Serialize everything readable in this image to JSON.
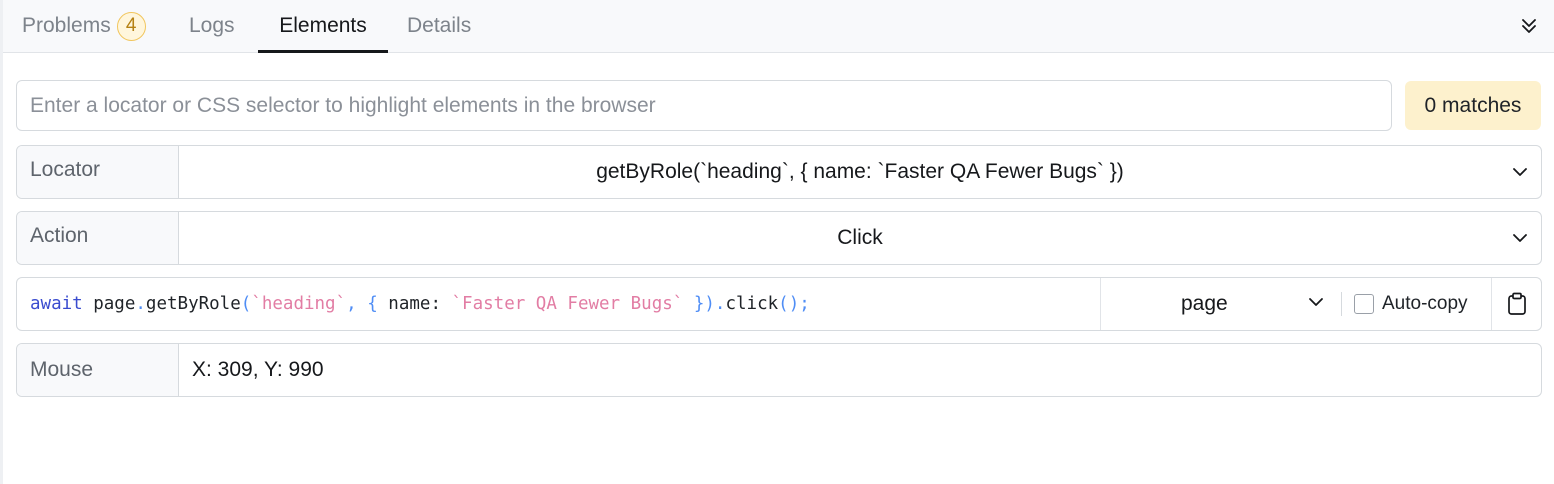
{
  "tabs": {
    "problems": {
      "label": "Problems",
      "badge": "4"
    },
    "logs": {
      "label": "Logs"
    },
    "elements": {
      "label": "Elements"
    },
    "details": {
      "label": "Details"
    },
    "active": "elements"
  },
  "header": {
    "collapse_icon": "chevrons-down-icon"
  },
  "locator_search": {
    "placeholder": "Enter a locator or CSS selector to highlight elements in the browser",
    "value": "",
    "matches": "0 matches"
  },
  "locator_row": {
    "label": "Locator",
    "value": "getByRole(`heading`, { name: `Faster QA Fewer Bugs` })"
  },
  "action_row": {
    "label": "Action",
    "value": "Click"
  },
  "code_row": {
    "tokens": [
      {
        "t": "await",
        "c": "kw"
      },
      {
        "t": " page",
        "c": ""
      },
      {
        "t": ".",
        "c": "punc"
      },
      {
        "t": "getByRole",
        "c": ""
      },
      {
        "t": "(",
        "c": "punc"
      },
      {
        "t": "`heading`",
        "c": "str"
      },
      {
        "t": ", { ",
        "c": "punc"
      },
      {
        "t": "name",
        "c": ""
      },
      {
        "t": ": ",
        "c": ""
      },
      {
        "t": "`Faster QA Fewer Bugs`",
        "c": "str"
      },
      {
        "t": " })",
        "c": "punc"
      },
      {
        "t": ".",
        "c": "punc"
      },
      {
        "t": "click",
        "c": ""
      },
      {
        "t": "();",
        "c": "punc"
      }
    ],
    "target": "page",
    "autocopy_label": "Auto-copy",
    "autocopy_checked": false
  },
  "mouse_row": {
    "label": "Mouse",
    "value": "X: 309, Y: 990"
  },
  "colors": {
    "keyword": "#3a4ccf",
    "punctuation": "#4f8df5",
    "string": "#e27da4",
    "matches_bg": "#fdf1cd",
    "badge_border": "#f1c65e"
  }
}
